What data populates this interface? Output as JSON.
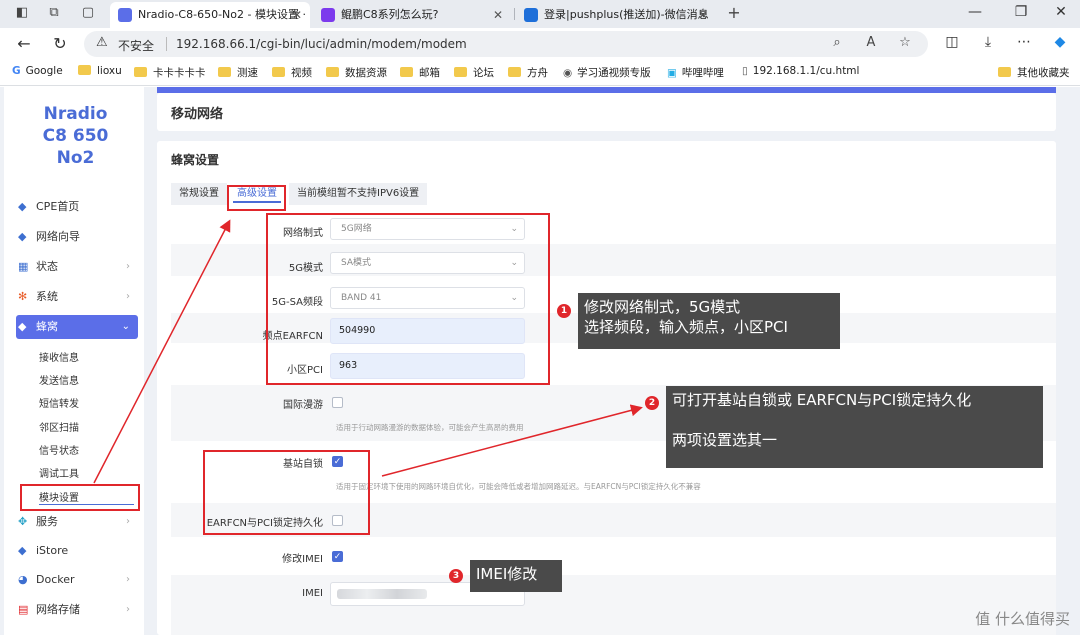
{
  "browser": {
    "tabs": [
      {
        "title": "Nradio-C8-650-No2 - 模块设置 ·",
        "active": true,
        "fav_color": "#5b6ee8"
      },
      {
        "title": "鲲鹏C8系列怎么玩?",
        "active": false,
        "fav_color": "#7c3aed"
      },
      {
        "title": "登录|pushplus(推送加)-微信消息",
        "active": false,
        "fav_color": "#1e6fd9"
      }
    ],
    "new_tab": "+",
    "window_controls": [
      "—",
      "❐",
      "✕"
    ],
    "security": "不安全",
    "url": "192.168.66.1/cgi-bin/luci/admin/modem/modem",
    "bookmarks": [
      "Google",
      "lioxu",
      "卡卡卡卡卡",
      "测速",
      "视频",
      "数据资源",
      "邮箱",
      "论坛",
      "方舟",
      "学习通视频专版",
      "哔哩哔哩",
      "192.168.1.1/cu.html"
    ],
    "other_bookmarks": "其他收藏夹"
  },
  "sidebar": {
    "logo_lines": [
      "Nradio",
      "C8 650",
      "No2"
    ],
    "menu": [
      {
        "label": "CPE首页",
        "icon": "cube-icon",
        "glyph": "◆",
        "chevron": false
      },
      {
        "label": "网络向导",
        "icon": "cube-icon",
        "glyph": "◆",
        "chevron": false
      },
      {
        "label": "状态",
        "icon": "grid-icon",
        "glyph": "▦",
        "chevron": true
      },
      {
        "label": "系统",
        "icon": "gear-icon",
        "glyph": "✻",
        "chevron": true
      },
      {
        "label": "蜂窝",
        "icon": "cube-icon",
        "glyph": "◆",
        "chevron": true,
        "active": true
      },
      {
        "label": "服务",
        "icon": "share-icon",
        "glyph": "✥",
        "chevron": true
      },
      {
        "label": "iStore",
        "icon": "cube-icon",
        "glyph": "◆",
        "chevron": false
      },
      {
        "label": "Docker",
        "icon": "docker-icon",
        "glyph": "◕",
        "chevron": true
      },
      {
        "label": "网络存储",
        "icon": "database-icon",
        "glyph": "▤",
        "chevron": true
      }
    ],
    "submenu": [
      "接收信息",
      "发送信息",
      "短信转发",
      "邻区扫描",
      "信号状态",
      "调试工具",
      "模块设置"
    ]
  },
  "main": {
    "page_title": "移动网络",
    "section_title": "蜂窝设置",
    "tabs": [
      "常规设置",
      "高级设置",
      "当前模组暂不支持IPV6设置"
    ],
    "fields": {
      "network_mode": {
        "label": "网络制式",
        "value": "5G网络"
      },
      "fiveg_mode": {
        "label": "5G模式",
        "value": "SA模式"
      },
      "band": {
        "label": "5G-SA频段",
        "value": "BAND 41"
      },
      "earfcn": {
        "label": "频点EARFCN",
        "value": "504990"
      },
      "pci": {
        "label": "小区PCI",
        "value": "963"
      },
      "roaming": {
        "label": "国际漫游",
        "checked": false,
        "hint": "适用于行动网路漫游的数据体验，可能会产生高昂的费用"
      },
      "cell_lock": {
        "label": "基站自锁",
        "checked": true,
        "hint": "适用于固定环境下使用的网路环境自优化，可能会降低或者增加网路延迟。与EARFCN与PCI锁定持久化不兼容"
      },
      "persist": {
        "label": "EARFCN与PCI锁定持久化",
        "checked": false
      },
      "modify_imei": {
        "label": "修改IMEI",
        "checked": true
      },
      "imei": {
        "label": "IMEI"
      }
    }
  },
  "annotations": {
    "n1": "1",
    "n2": "2",
    "n3": "3",
    "note1_line1": "修改网络制式，5G模式",
    "note1_line2": "选择频段，输入频点，小区PCI",
    "note2_line1": "可打开基站自锁或 EARFCN与PCI锁定持久化",
    "note2_line2": "两项设置选其一",
    "note3": "IMEI修改"
  },
  "watermark": "值 什么值得买",
  "colors": {
    "accent": "#5b6ee8",
    "annotation_red": "#e0262b",
    "note_bg": "#4a4a4a"
  }
}
